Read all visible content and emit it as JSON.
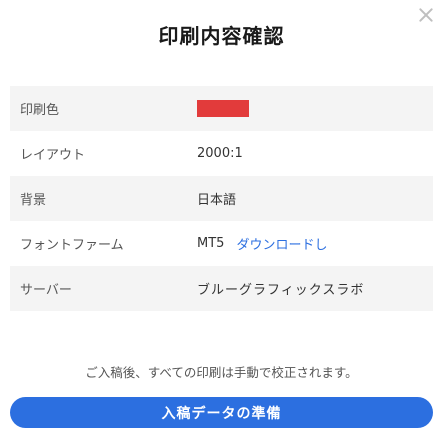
{
  "dialog": {
    "title": "印刷内容確認",
    "note": "ご入稿後、すべての印刷は手動で校正されます。",
    "cta_label": "入稿データの準備"
  },
  "details": [
    {
      "label": "印刷色",
      "value_type": "swatch",
      "swatch_color": "#e23b3b"
    },
    {
      "label": "レイアウト",
      "value": "2000:1"
    },
    {
      "label": "背景",
      "value": "日本語"
    },
    {
      "label": "フォントファーム",
      "value": "MT5",
      "link": "ダウンロードし"
    },
    {
      "label": "サーバー",
      "value": "ブルーグラフィックスラボ"
    }
  ],
  "colors": {
    "accent": "#2c6fe0",
    "swatch": "#e23b3b"
  }
}
